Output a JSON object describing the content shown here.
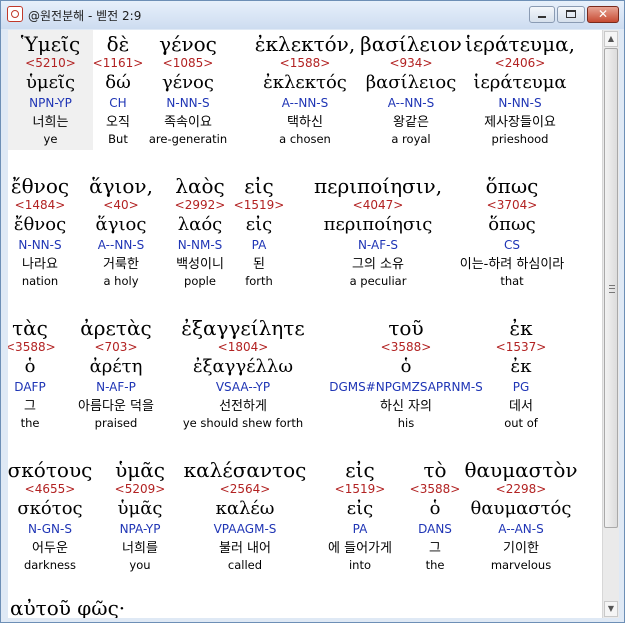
{
  "window": {
    "title": "@원전분해 - 벧전 2:9"
  },
  "rows": [
    [
      {
        "greek": "Ὑμεῖς",
        "strong": "<5210>",
        "lexical": "ὑμεῖς",
        "parsing": "NPN-YP",
        "korean": "너희는",
        "english": "ye",
        "selected": true
      },
      {
        "greek": "δὲ",
        "strong": "<1161>",
        "lexical": "δώ",
        "parsing": "CH",
        "korean": "오직",
        "english": "But"
      },
      {
        "greek": "γένος",
        "strong": "<1085>",
        "lexical": "γένος",
        "parsing": "N-NN-S",
        "korean": "족속이요",
        "english": "are-generatin"
      },
      {
        "greek": "ἐκλεκτόν,",
        "strong": "<1588>",
        "lexical": "ἐκλεκτός",
        "parsing": "A--NN-S",
        "korean": "택하신",
        "english": "a chosen"
      },
      {
        "greek": "βασίλειον",
        "strong": "<934>",
        "lexical": "βασίλειος",
        "parsing": "A--NN-S",
        "korean": "왕같은",
        "english": "a royal"
      },
      {
        "greek": "ἱεράτευμα,",
        "strong": "<2406>",
        "lexical": "ἱεράτευμα",
        "parsing": "N-NN-S",
        "korean": "제사장들이요",
        "english": "prieshood"
      }
    ],
    [
      {
        "greek": "ἔθνος",
        "strong": "<1484>",
        "lexical": "ἔθνος",
        "parsing": "N-NN-S",
        "korean": "나라요",
        "english": "nation"
      },
      {
        "greek": "ἅγιον,",
        "strong": "<40>",
        "lexical": "ἅγιος",
        "parsing": "A--NN-S",
        "korean": "거룩한",
        "english": "a holy"
      },
      {
        "greek": "λαὸς",
        "strong": "<2992>",
        "lexical": "λαός",
        "parsing": "N-NM-S",
        "korean": "백성이니",
        "english": "pople"
      },
      {
        "greek": "εἰς",
        "strong": "<1519>",
        "lexical": "εἰς",
        "parsing": "PA",
        "korean": "된",
        "english": "forth"
      },
      {
        "greek": "περιποίησιν,",
        "strong": "<4047>",
        "lexical": "περιποίησις",
        "parsing": "N-AF-S",
        "korean": "그의 소유",
        "english": "a peculiar"
      },
      {
        "greek": "ὅπως",
        "strong": "<3704>",
        "lexical": "ὅπως",
        "parsing": "CS",
        "korean": "이는-하려 하심이라",
        "english": "that"
      }
    ],
    [
      {
        "greek": "τὰς",
        "strong": "<3588>",
        "lexical": "ὁ",
        "parsing": "DAFP",
        "korean": "그",
        "english": "the"
      },
      {
        "greek": "ἀρετὰς",
        "strong": "<703>",
        "lexical": "ἀρέτη",
        "parsing": "N-AF-P",
        "korean": "아름다운 덕을",
        "english": "praised"
      },
      {
        "greek": "ἐξαγγείλητε",
        "strong": "<1804>",
        "lexical": "ἐξαγγέλλω",
        "parsing": "VSAA--YP",
        "korean": "선전하게",
        "english": "ye should shew forth"
      },
      {
        "greek": "τοῦ",
        "strong": "<3588>",
        "lexical": "ὁ",
        "parsing": "DGMS#NPGMZSAPRNM-S",
        "korean": "하신 자의",
        "english": "his"
      },
      {
        "greek": "ἐκ",
        "strong": "<1537>",
        "lexical": "ἐκ",
        "parsing": "PG",
        "korean": "데서",
        "english": "out of"
      }
    ],
    [
      {
        "greek": "σκότους",
        "strong": "<4655>",
        "lexical": "σκότος",
        "parsing": "N-GN-S",
        "korean": "어두운",
        "english": "darkness"
      },
      {
        "greek": "ὑμᾶς",
        "strong": "<5209>",
        "lexical": "ὑμᾶς",
        "parsing": "NPA-YP",
        "korean": "너희를",
        "english": "you"
      },
      {
        "greek": "καλέσαντος",
        "strong": "<2564>",
        "lexical": "καλέω",
        "parsing": "VPAAGM-S",
        "korean": "불러 내어",
        "english": "called"
      },
      {
        "greek": "εἰς",
        "strong": "<1519>",
        "lexical": "εἰς",
        "parsing": "PA",
        "korean": "에 들어가게",
        "english": "into"
      },
      {
        "greek": "τὸ",
        "strong": "<3588>",
        "lexical": "ὁ",
        "parsing": "DANS",
        "korean": "그",
        "english": "the"
      },
      {
        "greek": "θαυμαστὸν",
        "strong": "<2298>",
        "lexical": "θαυμαστός",
        "parsing": "A--AN-S",
        "korean": "기이한",
        "english": "marvelous"
      }
    ]
  ],
  "partial_line": "αὐτοῦ φῶς·"
}
